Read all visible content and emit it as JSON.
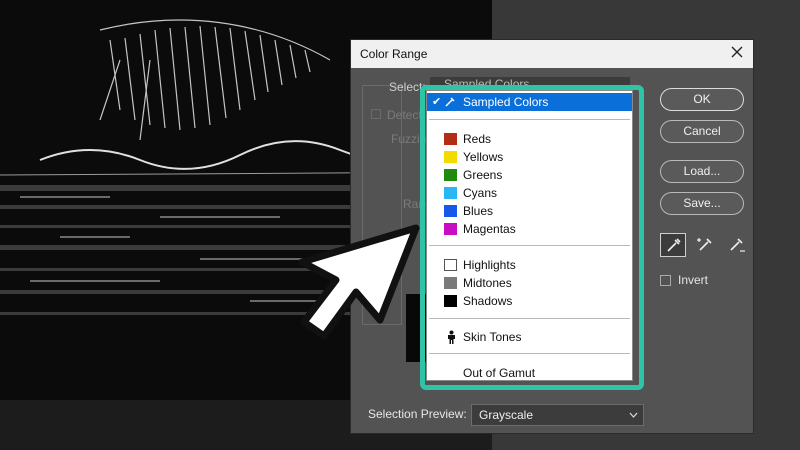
{
  "dialog": {
    "title": "Color Range",
    "select_label": "Select:",
    "select_value": "Sampled Colors",
    "detect_label": "Detect Faces",
    "fuzziness_label": "Fuzziness:",
    "range_label": "Range:",
    "preview_label": "Selection Preview:",
    "preview_value": "Grayscale",
    "invert_label": "Invert",
    "buttons": {
      "ok": "OK",
      "cancel": "Cancel",
      "load": "Load...",
      "save": "Save..."
    }
  },
  "dropdown": {
    "items": [
      {
        "label": "Sampled Colors",
        "selected": true
      },
      {
        "label": "Reds",
        "color": "#b32d12"
      },
      {
        "label": "Yellows",
        "color": "#f2dc00"
      },
      {
        "label": "Greens",
        "color": "#1f8a0e"
      },
      {
        "label": "Cyans",
        "color": "#29b6f2"
      },
      {
        "label": "Blues",
        "color": "#1659e8"
      },
      {
        "label": "Magentas",
        "color": "#c80ec2"
      },
      {
        "label": "Highlights",
        "color": "#ffffff"
      },
      {
        "label": "Midtones",
        "color": "#7a7a7a"
      },
      {
        "label": "Shadows",
        "color": "#000000"
      },
      {
        "label": "Skin Tones",
        "icon": "person-icon"
      },
      {
        "label": "Out of Gamut"
      }
    ]
  },
  "colors": {
    "highlight_border": "#2ec4a6",
    "selected_item": "#0a6fd8",
    "dialog_bg": "#535353"
  }
}
